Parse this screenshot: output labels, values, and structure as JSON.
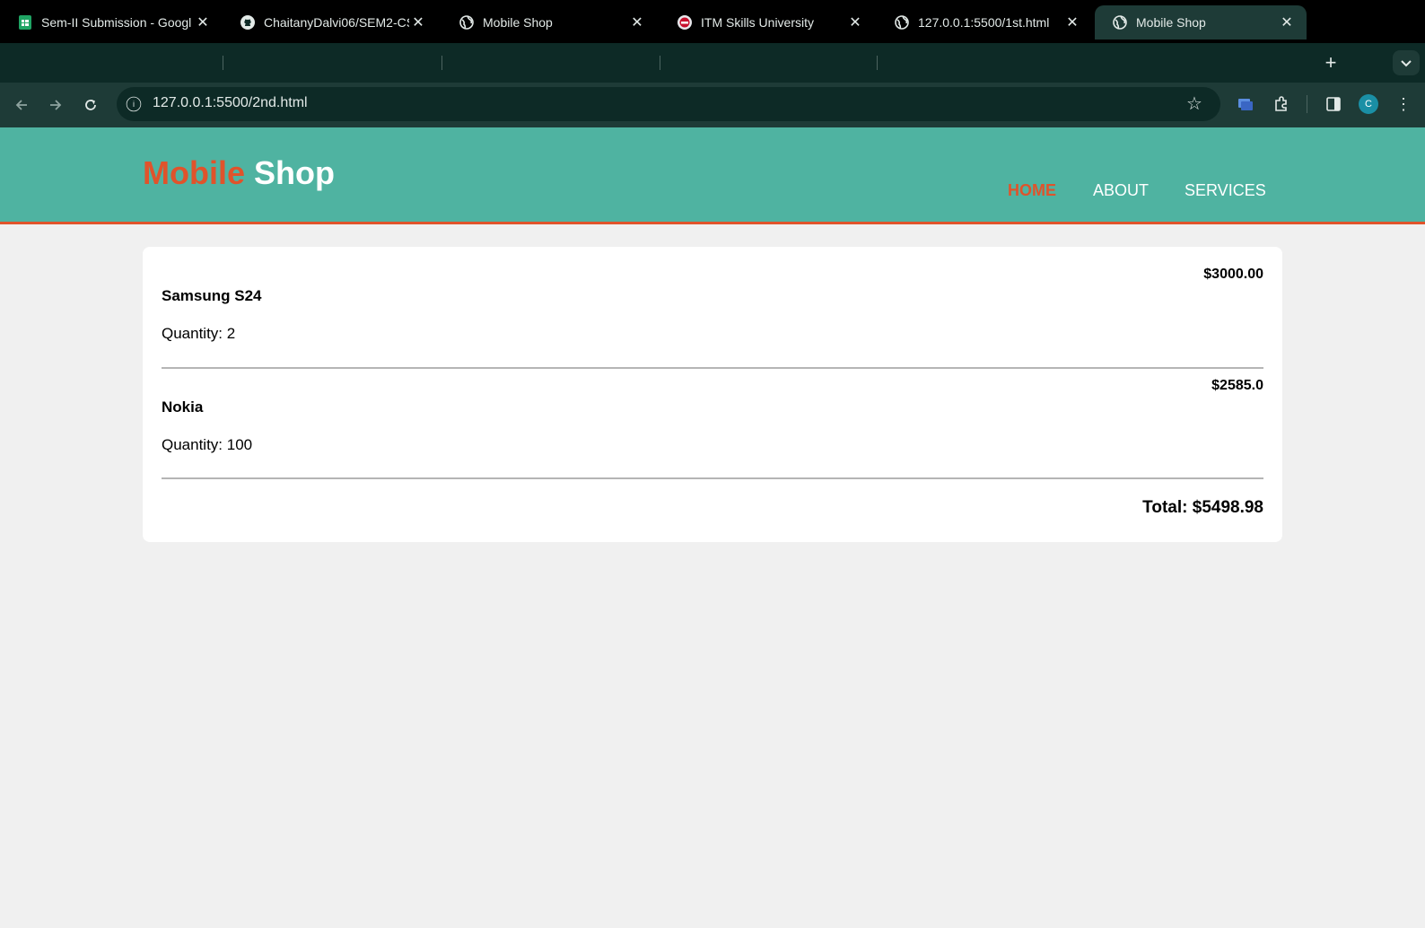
{
  "browser": {
    "tabs": [
      {
        "title": "Sem-II Submission - Googl",
        "favicon": "sheets-icon",
        "active": false
      },
      {
        "title": "ChaitanyDalvi06/SEM2-CS",
        "favicon": "github-icon",
        "active": false
      },
      {
        "title": "Mobile Shop",
        "favicon": "globe-icon",
        "active": false
      },
      {
        "title": "ITM Skills University",
        "favicon": "itm-icon",
        "active": false
      },
      {
        "title": "127.0.0.1:5500/1st.html",
        "favicon": "globe-icon",
        "active": false
      },
      {
        "title": "Mobile Shop",
        "favicon": "globe-icon",
        "active": true
      }
    ],
    "url": "127.0.0.1:5500/2nd.html",
    "profile_initial": "C"
  },
  "site": {
    "logo_part1": "Mobile",
    "logo_part2": "Shop",
    "nav": [
      "HOME",
      "ABOUT",
      "SERVICES"
    ],
    "colors": {
      "header": "#4fb3a1",
      "accent": "#e0532b"
    }
  },
  "cart": {
    "items": [
      {
        "name": "Samsung S24",
        "price": "$3000.00",
        "quantity": "Quantity: 2"
      },
      {
        "name": "Nokia",
        "price": "$2585.0",
        "quantity": "Quantity: 100"
      }
    ],
    "total": "Total: $5498.98"
  }
}
